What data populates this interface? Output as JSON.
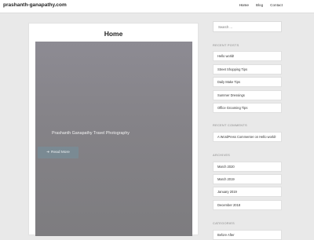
{
  "site": {
    "title": "prashanth-ganapathy.com"
  },
  "nav": {
    "items": [
      "Home",
      "Blog",
      "Contact"
    ]
  },
  "main": {
    "page_title": "Home",
    "hero_caption": "Prashanth Ganapathy Travel Photography",
    "read_more_label": "Read More",
    "read_more_icon": "arrow-right-icon"
  },
  "sidebar": {
    "search_placeholder": "Search ...",
    "recent_posts": {
      "title": "RECENT POSTS",
      "items": [
        "Hello world!",
        "Street Shopping Tips",
        "Daily Make Tips",
        "Summer Dressings",
        "Office Grooming Tips"
      ]
    },
    "recent_comments": {
      "title": "RECENT COMMENTS",
      "author": "A WordPress Commenter",
      "connector": "on",
      "post": "Hello world!"
    },
    "archives": {
      "title": "ARCHIVES",
      "items": [
        "March 2020",
        "March 2019",
        "January 2019",
        "December 2018"
      ]
    },
    "categories": {
      "title": "CATEGORIES",
      "items": [
        "Before After"
      ]
    }
  },
  "colors": {
    "page_background": "#e9e9e9",
    "hero_overlay": "#858388",
    "button": "#7a8a93"
  }
}
